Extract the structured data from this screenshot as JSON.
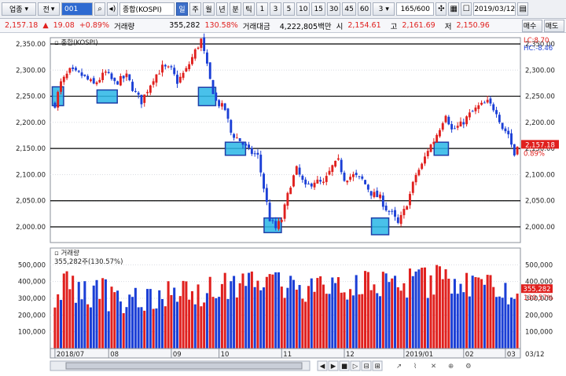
{
  "toolbar": {
    "market_type": "업종",
    "market_sub": "전",
    "code": "001",
    "search_icon": "search-icon",
    "sound_icon": "speaker-icon",
    "name": "종합(KOSPI)",
    "periods": [
      "일",
      "주",
      "월",
      "년",
      "분",
      "틱"
    ],
    "active_period": "일",
    "intervals": [
      "1",
      "3",
      "5",
      "10",
      "15",
      "30",
      "45",
      "60"
    ],
    "interval_value": "3",
    "count": "165/600",
    "date": "2019/03/12"
  },
  "quote": {
    "price": "2,157.18",
    "arrow": "▲",
    "change": "19.08",
    "change_pct": "+0.89%",
    "volume_label": "거래량",
    "volume": "355,282",
    "volume_ratio": "130.58%",
    "amount_label": "거래대금",
    "amount": "4,222,805백만",
    "open_label": "시",
    "open": "2,154.61",
    "high_label": "고",
    "high": "2,161.69",
    "low_label": "저",
    "low": "2,150.96",
    "buttons": [
      "매수",
      "매도"
    ]
  },
  "colors": {
    "up": "#e0201e",
    "down": "#1b3fd6",
    "highlight": "#29b6e6",
    "highlight_stroke": "#1f3fa8"
  },
  "chart_data": [
    {
      "type": "candlestick",
      "title": "종합(KOSPI)",
      "ylim": [
        1970,
        2362
      ],
      "y_ticks": [
        "2,350.00",
        "2,300.00",
        "2,250.00",
        "2,200.00",
        "2,150.00",
        "2,100.00",
        "2,050.00",
        "2,000.00"
      ],
      "y_tick_values": [
        2350,
        2300,
        2250,
        2200,
        2150,
        2100,
        2050,
        2000
      ],
      "horizontal_lines": [
        2350,
        2250,
        2150,
        2050,
        2000
      ],
      "anchors": [
        [
          0,
          2235
        ],
        [
          2,
          2275
        ],
        [
          5,
          2298
        ],
        [
          9,
          2290
        ],
        [
          13,
          2272
        ],
        [
          17,
          2295
        ],
        [
          20,
          2275
        ],
        [
          24,
          2288
        ],
        [
          27,
          2255
        ],
        [
          29,
          2240
        ],
        [
          33,
          2285
        ],
        [
          36,
          2305
        ],
        [
          39,
          2300
        ],
        [
          41,
          2278
        ],
        [
          44,
          2300
        ],
        [
          47,
          2336
        ],
        [
          49,
          2358
        ],
        [
          52,
          2280
        ],
        [
          54,
          2240
        ],
        [
          57,
          2225
        ],
        [
          59,
          2180
        ],
        [
          62,
          2165
        ],
        [
          65,
          2145
        ],
        [
          68,
          2135
        ],
        [
          70,
          2075
        ],
        [
          72,
          2015
        ],
        [
          74,
          1997
        ],
        [
          76,
          2015
        ],
        [
          79,
          2082
        ],
        [
          81,
          2110
        ],
        [
          84,
          2075
        ],
        [
          87,
          2088
        ],
        [
          90,
          2082
        ],
        [
          93,
          2115
        ],
        [
          95,
          2125
        ],
        [
          97,
          2093
        ],
        [
          100,
          2098
        ],
        [
          103,
          2090
        ],
        [
          106,
          2065
        ],
        [
          109,
          2055
        ],
        [
          111,
          2035
        ],
        [
          113,
          2025
        ],
        [
          115,
          2005
        ],
        [
          117,
          2030
        ],
        [
          119,
          2062
        ],
        [
          121,
          2100
        ],
        [
          123,
          2118
        ],
        [
          125,
          2148
        ],
        [
          127,
          2165
        ],
        [
          129,
          2190
        ],
        [
          131,
          2218
        ],
        [
          133,
          2185
        ],
        [
          136,
          2195
        ],
        [
          139,
          2215
        ],
        [
          142,
          2230
        ],
        [
          145,
          2238
        ],
        [
          148,
          2222
        ],
        [
          150,
          2190
        ],
        [
          152,
          2178
        ],
        [
          154,
          2138
        ],
        [
          155,
          2160
        ]
      ],
      "highlight_boxes": [
        {
          "from": 0,
          "to": 2,
          "low": 2232,
          "high": 2268
        },
        {
          "from": 15,
          "to": 20,
          "low": 2237,
          "high": 2262
        },
        {
          "from": 49,
          "to": 53,
          "low": 2232,
          "high": 2267
        },
        {
          "from": 58,
          "to": 63,
          "low": 2137,
          "high": 2162
        },
        {
          "from": 71,
          "to": 75,
          "low": 1989,
          "high": 2017
        },
        {
          "from": 107,
          "to": 111,
          "low": 1985,
          "high": 2017
        },
        {
          "from": 128,
          "to": 131,
          "low": 2137,
          "high": 2162
        }
      ],
      "right_labels": {
        "lc": "LC:8.70",
        "hc": "HC:-8.46",
        "current_price": "2,157.18",
        "current_pct": "0.89%"
      }
    },
    {
      "type": "bar",
      "title": "거래량",
      "subtitle": "355,282주(130.57%)",
      "ylim": [
        0,
        600000
      ],
      "y_ticks": [
        "500,000",
        "400,000",
        "300,000",
        "200,000",
        "100,000"
      ],
      "y_tick_values": [
        500000,
        400000,
        300000,
        200000,
        100000
      ],
      "anchors": [
        [
          0,
          340000
        ],
        [
          5,
          395000
        ],
        [
          10,
          320000
        ],
        [
          15,
          335000
        ],
        [
          20,
          300000
        ],
        [
          25,
          310000
        ],
        [
          30,
          285000
        ],
        [
          35,
          345000
        ],
        [
          40,
          320000
        ],
        [
          45,
          305000
        ],
        [
          50,
          330000
        ],
        [
          55,
          375000
        ],
        [
          60,
          390000
        ],
        [
          65,
          385000
        ],
        [
          70,
          420000
        ],
        [
          75,
          395000
        ],
        [
          80,
          370000
        ],
        [
          85,
          375000
        ],
        [
          90,
          355000
        ],
        [
          95,
          340000
        ],
        [
          100,
          395000
        ],
        [
          105,
          370000
        ],
        [
          110,
          395000
        ],
        [
          115,
          375000
        ],
        [
          120,
          385000
        ],
        [
          125,
          395000
        ],
        [
          130,
          420000
        ],
        [
          135,
          405000
        ],
        [
          140,
          400000
        ],
        [
          145,
          395000
        ],
        [
          150,
          355000
        ],
        [
          155,
          330000
        ]
      ],
      "right_labels": {
        "current_volume": "355,282",
        "current_pct": "130.57%"
      }
    }
  ],
  "x_axis": {
    "labels": [
      {
        "text": "2018/07",
        "index": 0
      },
      {
        "text": "08",
        "index": 18
      },
      {
        "text": "09",
        "index": 39
      },
      {
        "text": "10",
        "index": 55
      },
      {
        "text": "11",
        "index": 76
      },
      {
        "text": "12",
        "index": 97
      },
      {
        "text": "2019/01",
        "index": 117
      },
      {
        "text": "02",
        "index": 137
      },
      {
        "text": "03",
        "index": 151
      }
    ],
    "right_label": "03/12",
    "candle_count": 156
  }
}
